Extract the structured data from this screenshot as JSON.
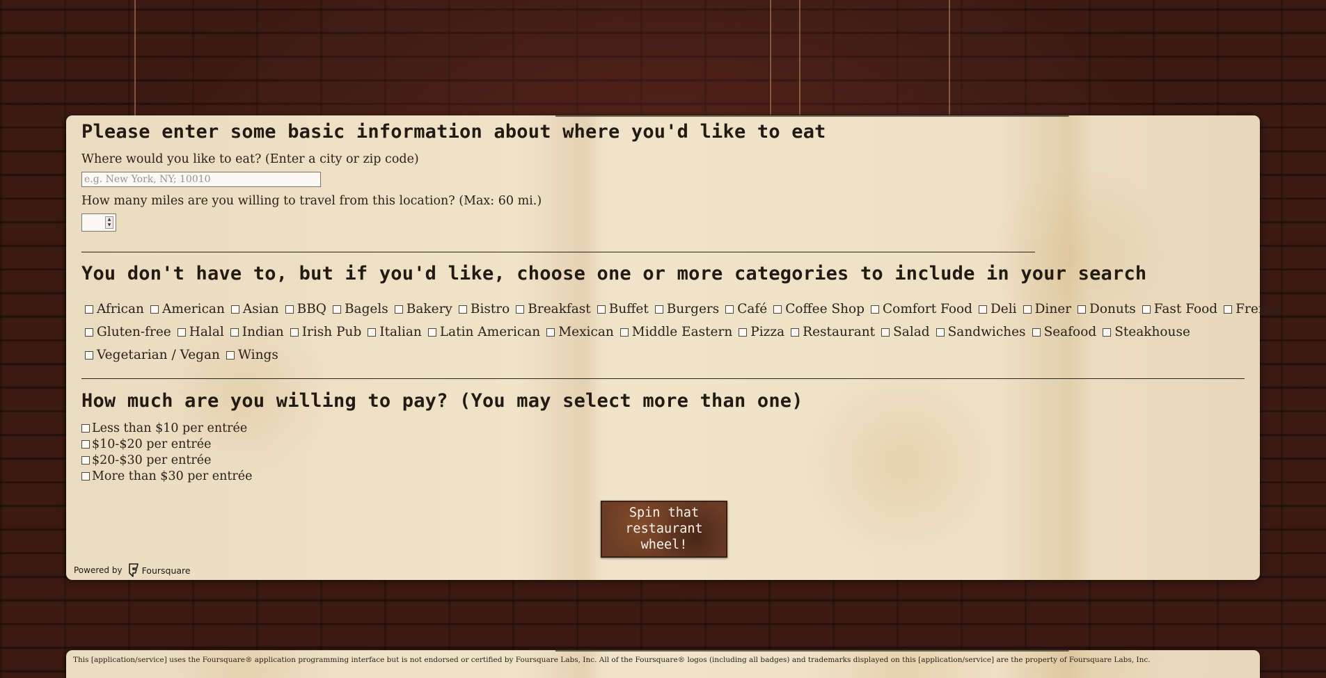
{
  "section1": {
    "heading": "Please enter some basic information about where you'd like to eat",
    "location_label": "Where would you like to eat? (Enter a city or zip code)",
    "location_placeholder": "e.g. New York, NY; 10010",
    "location_value": "",
    "miles_label": "How many miles are you willing to travel from this location? (Max: 60 mi.)",
    "miles_value": ""
  },
  "section2": {
    "heading": "You don't have to, but if you'd like, choose one or more categories to include in your search",
    "rows": [
      [
        "African",
        "American",
        "Asian",
        "BBQ",
        "Bagels",
        "Bakery",
        "Bistro",
        "Breakfast",
        "Buffet",
        "Burgers",
        "Café",
        "Coffee Shop",
        "Comfort Food",
        "Deli",
        "Diner",
        "Donuts",
        "Fast Food",
        "French"
      ],
      [
        "Gluten-free",
        "Halal",
        "Indian",
        "Irish Pub",
        "Italian",
        "Latin American",
        "Mexican",
        "Middle Eastern",
        "Pizza",
        "Restaurant",
        "Salad",
        "Sandwiches",
        "Seafood",
        "Steakhouse"
      ],
      [
        "Vegetarian / Vegan",
        "Wings"
      ]
    ]
  },
  "section3": {
    "heading": "How much are you willing to pay? (You may select more than one)",
    "options": [
      "Less than $10 per entrée",
      "$10-$20 per entrée",
      "$20-$30 per entrée",
      "More than $30 per entrée"
    ]
  },
  "submit": {
    "line1": "Spin that",
    "line2": "restaurant",
    "line3": "wheel!"
  },
  "powered": {
    "prefix": "Powered by",
    "brand": "Foursquare",
    "icon": "foursquare-logo-icon"
  },
  "footer": {
    "disclaimer": "This [application/service] uses the Foursquare® application programming interface but is not endorsed or certified by Foursquare Labs, Inc. All of the Foursquare® logos (including all badges) and trademarks displayed on this [application/service] are the property of Foursquare Labs, Inc."
  }
}
